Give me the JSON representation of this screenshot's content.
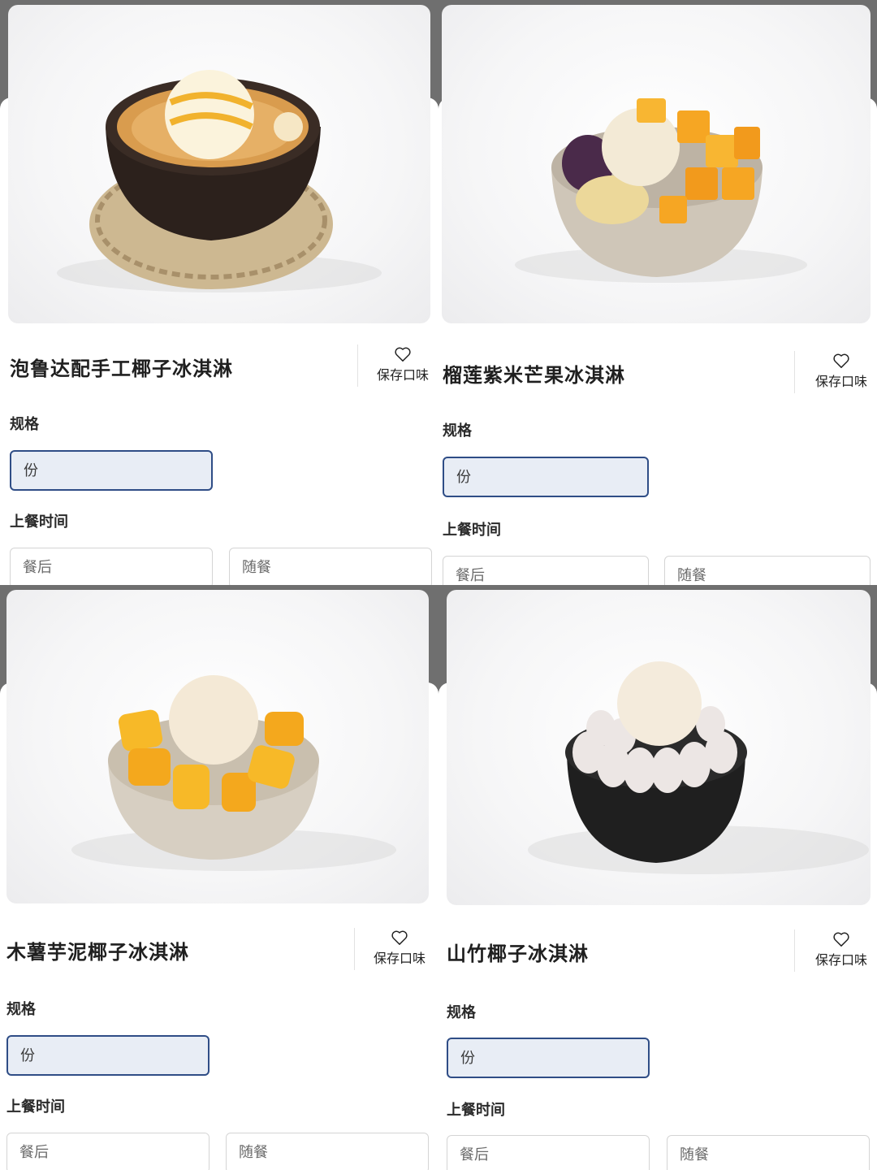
{
  "products": [
    {
      "name": "泡鲁达配手工椰子冰淇淋",
      "save_label": "保存口味",
      "spec_label": "规格",
      "spec_selected": "份",
      "time_label": "上餐时间",
      "time_options": [
        "餐后",
        "随餐"
      ]
    },
    {
      "name": "榴莲紫米芒果冰淇淋",
      "save_label": "保存口味",
      "spec_label": "规格",
      "spec_selected": "份",
      "time_label": "上餐时间",
      "time_options": [
        "餐后",
        "随餐"
      ]
    },
    {
      "name": "木薯芋泥椰子冰淇淋",
      "save_label": "保存口味",
      "spec_label": "规格",
      "spec_selected": "份",
      "time_label": "上餐时间",
      "time_options": [
        "餐后",
        "随餐"
      ]
    },
    {
      "name": "山竹椰子冰淇淋",
      "save_label": "保存口味",
      "spec_label": "规格",
      "spec_selected": "份",
      "time_label": "上餐时间",
      "time_options": [
        "餐后",
        "随餐"
      ]
    }
  ],
  "colors": {
    "selected_border": "#2f4d86",
    "selected_fill": "#e8edf5",
    "overlay": "#6f6f6f"
  },
  "icons": {
    "save": "heart-outline-icon"
  }
}
